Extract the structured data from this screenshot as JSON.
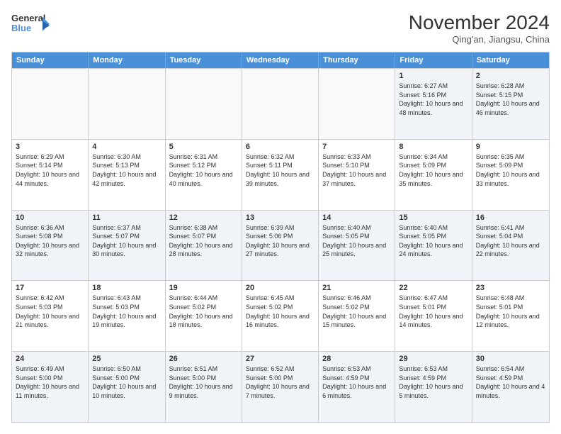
{
  "logo": {
    "line1": "General",
    "line2": "Blue"
  },
  "title": "November 2024",
  "location": "Qing'an, Jiangsu, China",
  "days_header": [
    "Sunday",
    "Monday",
    "Tuesday",
    "Wednesday",
    "Thursday",
    "Friday",
    "Saturday"
  ],
  "rows": [
    [
      {
        "day": "",
        "text": "",
        "empty": true
      },
      {
        "day": "",
        "text": "",
        "empty": true
      },
      {
        "day": "",
        "text": "",
        "empty": true
      },
      {
        "day": "",
        "text": "",
        "empty": true
      },
      {
        "day": "",
        "text": "",
        "empty": true
      },
      {
        "day": "1",
        "text": "Sunrise: 6:27 AM\nSunset: 5:16 PM\nDaylight: 10 hours and 48 minutes."
      },
      {
        "day": "2",
        "text": "Sunrise: 6:28 AM\nSunset: 5:15 PM\nDaylight: 10 hours and 46 minutes."
      }
    ],
    [
      {
        "day": "3",
        "text": "Sunrise: 6:29 AM\nSunset: 5:14 PM\nDaylight: 10 hours and 44 minutes."
      },
      {
        "day": "4",
        "text": "Sunrise: 6:30 AM\nSunset: 5:13 PM\nDaylight: 10 hours and 42 minutes."
      },
      {
        "day": "5",
        "text": "Sunrise: 6:31 AM\nSunset: 5:12 PM\nDaylight: 10 hours and 40 minutes."
      },
      {
        "day": "6",
        "text": "Sunrise: 6:32 AM\nSunset: 5:11 PM\nDaylight: 10 hours and 39 minutes."
      },
      {
        "day": "7",
        "text": "Sunrise: 6:33 AM\nSunset: 5:10 PM\nDaylight: 10 hours and 37 minutes."
      },
      {
        "day": "8",
        "text": "Sunrise: 6:34 AM\nSunset: 5:09 PM\nDaylight: 10 hours and 35 minutes."
      },
      {
        "day": "9",
        "text": "Sunrise: 6:35 AM\nSunset: 5:09 PM\nDaylight: 10 hours and 33 minutes."
      }
    ],
    [
      {
        "day": "10",
        "text": "Sunrise: 6:36 AM\nSunset: 5:08 PM\nDaylight: 10 hours and 32 minutes."
      },
      {
        "day": "11",
        "text": "Sunrise: 6:37 AM\nSunset: 5:07 PM\nDaylight: 10 hours and 30 minutes."
      },
      {
        "day": "12",
        "text": "Sunrise: 6:38 AM\nSunset: 5:07 PM\nDaylight: 10 hours and 28 minutes."
      },
      {
        "day": "13",
        "text": "Sunrise: 6:39 AM\nSunset: 5:06 PM\nDaylight: 10 hours and 27 minutes."
      },
      {
        "day": "14",
        "text": "Sunrise: 6:40 AM\nSunset: 5:05 PM\nDaylight: 10 hours and 25 minutes."
      },
      {
        "day": "15",
        "text": "Sunrise: 6:40 AM\nSunset: 5:05 PM\nDaylight: 10 hours and 24 minutes."
      },
      {
        "day": "16",
        "text": "Sunrise: 6:41 AM\nSunset: 5:04 PM\nDaylight: 10 hours and 22 minutes."
      }
    ],
    [
      {
        "day": "17",
        "text": "Sunrise: 6:42 AM\nSunset: 5:03 PM\nDaylight: 10 hours and 21 minutes."
      },
      {
        "day": "18",
        "text": "Sunrise: 6:43 AM\nSunset: 5:03 PM\nDaylight: 10 hours and 19 minutes."
      },
      {
        "day": "19",
        "text": "Sunrise: 6:44 AM\nSunset: 5:02 PM\nDaylight: 10 hours and 18 minutes."
      },
      {
        "day": "20",
        "text": "Sunrise: 6:45 AM\nSunset: 5:02 PM\nDaylight: 10 hours and 16 minutes."
      },
      {
        "day": "21",
        "text": "Sunrise: 6:46 AM\nSunset: 5:02 PM\nDaylight: 10 hours and 15 minutes."
      },
      {
        "day": "22",
        "text": "Sunrise: 6:47 AM\nSunset: 5:01 PM\nDaylight: 10 hours and 14 minutes."
      },
      {
        "day": "23",
        "text": "Sunrise: 6:48 AM\nSunset: 5:01 PM\nDaylight: 10 hours and 12 minutes."
      }
    ],
    [
      {
        "day": "24",
        "text": "Sunrise: 6:49 AM\nSunset: 5:00 PM\nDaylight: 10 hours and 11 minutes."
      },
      {
        "day": "25",
        "text": "Sunrise: 6:50 AM\nSunset: 5:00 PM\nDaylight: 10 hours and 10 minutes."
      },
      {
        "day": "26",
        "text": "Sunrise: 6:51 AM\nSunset: 5:00 PM\nDaylight: 10 hours and 9 minutes."
      },
      {
        "day": "27",
        "text": "Sunrise: 6:52 AM\nSunset: 5:00 PM\nDaylight: 10 hours and 7 minutes."
      },
      {
        "day": "28",
        "text": "Sunrise: 6:53 AM\nSunset: 4:59 PM\nDaylight: 10 hours and 6 minutes."
      },
      {
        "day": "29",
        "text": "Sunrise: 6:53 AM\nSunset: 4:59 PM\nDaylight: 10 hours and 5 minutes."
      },
      {
        "day": "30",
        "text": "Sunrise: 6:54 AM\nSunset: 4:59 PM\nDaylight: 10 hours and 4 minutes."
      }
    ]
  ]
}
